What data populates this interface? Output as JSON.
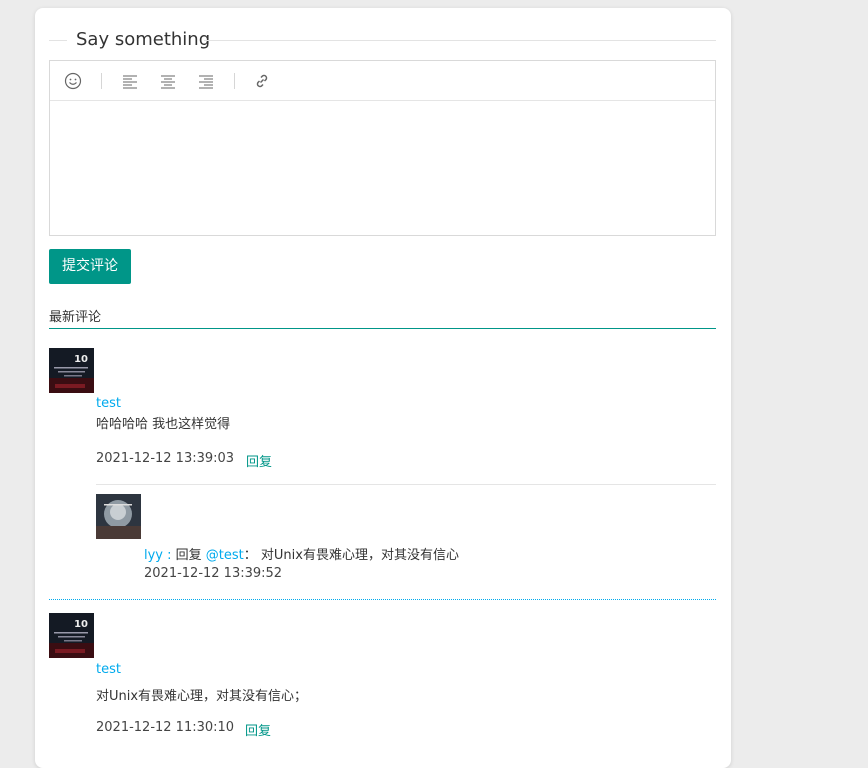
{
  "editor": {
    "legend": "Say something",
    "toolbar": [
      "emoji-icon",
      "align-left-icon",
      "align-center-icon",
      "align-right-icon",
      "link-icon"
    ],
    "submit_label": "提交评论"
  },
  "comments_section": {
    "title": "最新评论"
  },
  "comments": [
    {
      "user": "test",
      "content": "哈哈哈哈  我也这样觉得",
      "time": "2021-12-12 13:39:03",
      "reply_label": "回复",
      "replies": [
        {
          "user": "lyy",
          "separator": " : ",
          "reply_word": "回复 ",
          "target": "@test",
          "colon": "：",
          "content": " 对Unix有畏难心理，对其没有信心",
          "time": "2021-12-12 13:39:52"
        }
      ]
    },
    {
      "user": "test",
      "content": "对Unix有畏难心理，对其没有信心；",
      "time": "2021-12-12 11:30:10",
      "reply_label": "回复"
    }
  ],
  "colors": {
    "accent": "#009688",
    "link": "#01aaed"
  }
}
